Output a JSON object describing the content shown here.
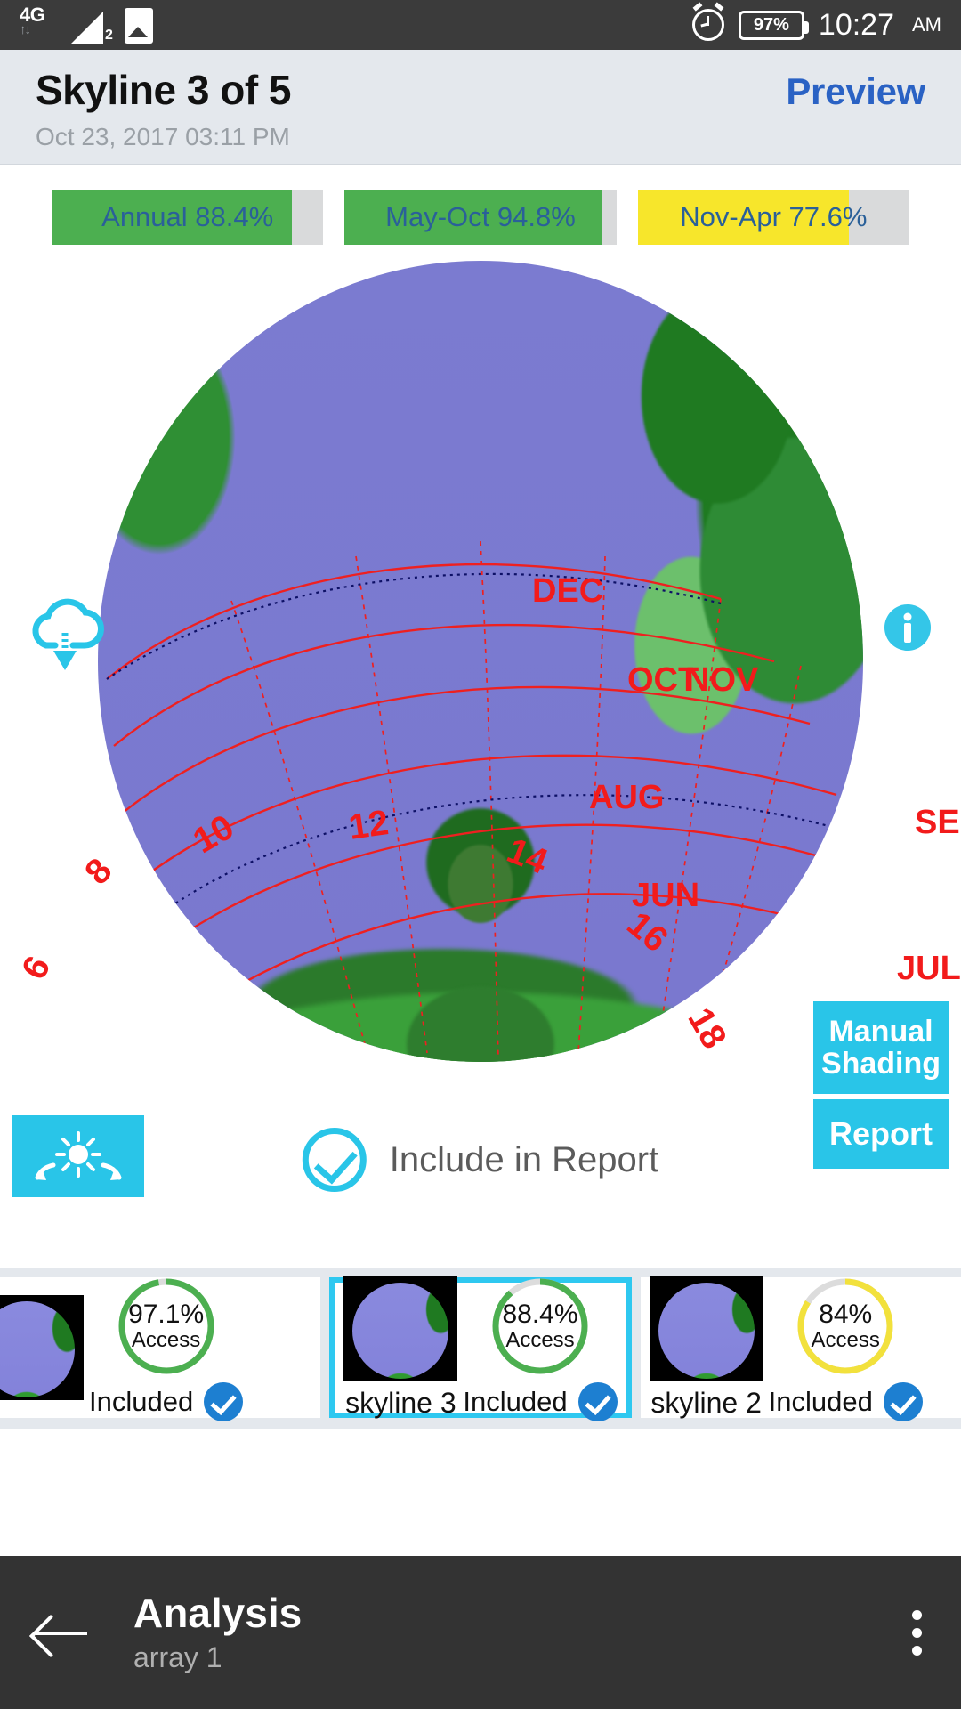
{
  "statusbar": {
    "network": "4G",
    "network_arrows": "↑↓",
    "signal_sub": "2",
    "gallery_icon": "image-icon",
    "alarm_icon": "alarm-icon",
    "battery": "97%",
    "time": "10:27",
    "ampm": "AM"
  },
  "header": {
    "title": "Skyline 3 of 5",
    "preview": "Preview",
    "timestamp": "Oct 23, 2017 03:11 PM"
  },
  "bars": [
    {
      "label": "Annual 88.4%",
      "value": 88.4,
      "color": "#4caf50",
      "track": "#d9dadb"
    },
    {
      "label": "May-Oct 94.8%",
      "value": 94.8,
      "color": "#4caf50",
      "track": "#d9dadb"
    },
    {
      "label": "Nov-Apr 77.6%",
      "value": 77.6,
      "color": "#f7e62b",
      "track": "#d9dadb"
    }
  ],
  "viewer": {
    "cloud_download_icon": "cloud-download-icon",
    "info_icon": "info-icon",
    "month_labels": [
      "DEC",
      "NOV",
      "OCT",
      "SEP",
      "AUG",
      "JUL",
      "JUN"
    ],
    "hour_labels": [
      "6",
      "8",
      "10",
      "12",
      "14",
      "16",
      "18"
    ]
  },
  "controls": {
    "sun_button_icon": "sun-rotate-icon",
    "include_label": "Include in Report",
    "include_checked": true,
    "manual_shading": "Manual Shading",
    "manual_shading_line1": "Manual",
    "manual_shading_line2": "Shading",
    "report": "Report"
  },
  "cards": [
    {
      "name": "",
      "percent": "97.1%",
      "access_label": "Access",
      "ring_color": "#4caf50",
      "ring_value": 97.1,
      "included_label": "Included",
      "included": true,
      "selected": false
    },
    {
      "name": "skyline 3",
      "percent": "88.4%",
      "access_label": "Access",
      "ring_color": "#4caf50",
      "ring_value": 88.4,
      "included_label": "Included",
      "included": true,
      "selected": true
    },
    {
      "name": "skyline 2",
      "percent": "84%",
      "access_label": "Access",
      "ring_color": "#f2e13c",
      "ring_value": 84,
      "included_label": "Included",
      "included": true,
      "selected": false
    }
  ],
  "bottombar": {
    "back_icon": "back-arrow-icon",
    "title": "Analysis",
    "subtitle": "array 1",
    "overflow_icon": "more-vertical-icon"
  },
  "colors": {
    "accent_cyan": "#29c5e8",
    "link_blue": "#2a62c4",
    "green": "#4caf50",
    "yellow": "#f7e62b",
    "sunpath_red": "#f21b1b"
  }
}
